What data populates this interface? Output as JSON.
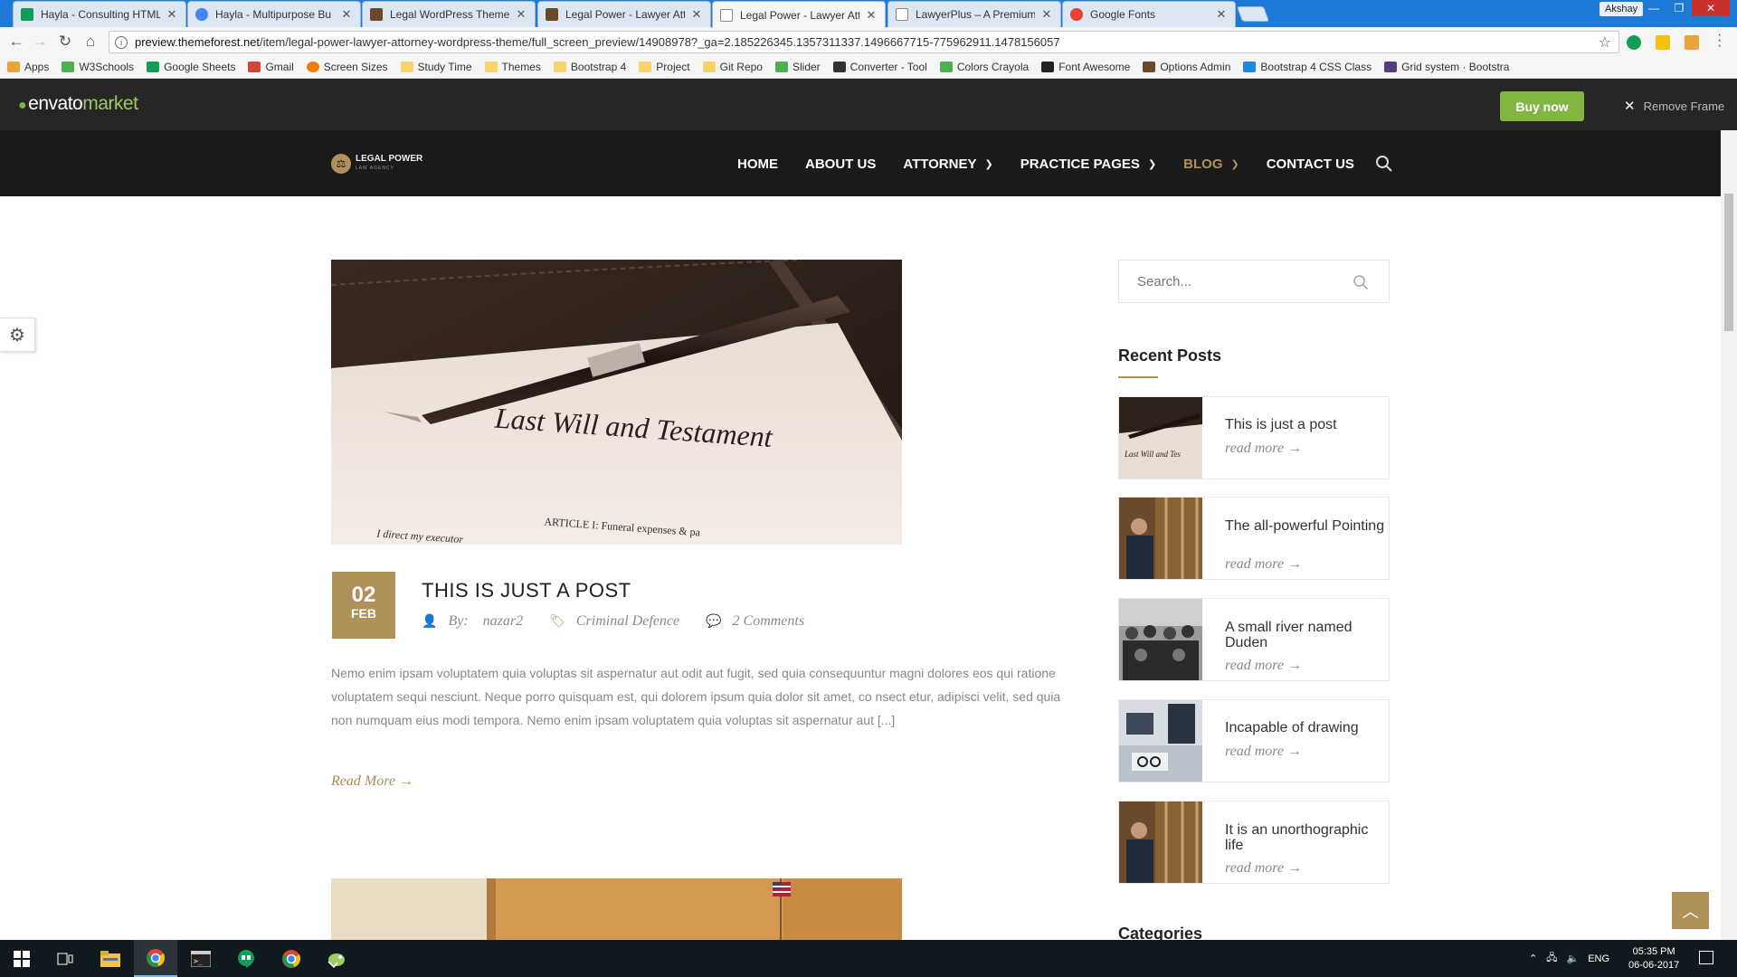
{
  "browser": {
    "tabs": [
      {
        "label": "Hayla - Consulting HTML",
        "favicon_color": "#0f9d58",
        "active": false
      },
      {
        "label": "Hayla - Multipurpose Bu",
        "favicon_color": "#4285f4",
        "active": false
      },
      {
        "label": "Legal WordPress Theme",
        "favicon_color": "#6b4a2a",
        "active": false
      },
      {
        "label": "Legal Power - Lawyer Att",
        "favicon_color": "#6b4a2a",
        "active": false
      },
      {
        "label": "Legal Power - Lawyer Att",
        "favicon_color": "#888888",
        "active": true
      },
      {
        "label": "LawyerPlus – A Premium",
        "favicon_color": "#888888",
        "active": false
      },
      {
        "label": "Google Fonts",
        "favicon_color": "#e94235",
        "active": false
      }
    ],
    "profile_name": "Akshay",
    "url_host": "preview.themeforest.net",
    "url_path": "/item/legal-power-lawyer-attorney-wordpress-theme/full_screen_preview/14908978?_ga=2.185226345.1357311337.1496667715-775962911.1478156057",
    "bookmarks": [
      {
        "label": "Apps",
        "color": "#e8a33c"
      },
      {
        "label": "W3Schools",
        "color": "#4caf50"
      },
      {
        "label": "Google Sheets",
        "color": "#0f9d58"
      },
      {
        "label": "Gmail",
        "color": "#d44638"
      },
      {
        "label": "Screen Sizes",
        "color": "#f57c00"
      },
      {
        "label": "Study Time",
        "color": "#f7d46b"
      },
      {
        "label": "Themes",
        "color": "#f7d46b"
      },
      {
        "label": "Bootstrap 4",
        "color": "#f7d46b"
      },
      {
        "label": "Project",
        "color": "#f7d46b"
      },
      {
        "label": "Git Repo",
        "color": "#f7d46b"
      },
      {
        "label": "Slider",
        "color": "#4caf50"
      },
      {
        "label": "Converter - Tool",
        "color": "#333333"
      },
      {
        "label": "Colors Crayola",
        "color": "#4caf50"
      },
      {
        "label": "Font Awesome",
        "color": "#222222"
      },
      {
        "label": "Options Admin",
        "color": "#6b4a2a"
      },
      {
        "label": "Bootstrap 4 CSS Class",
        "color": "#1e88e5"
      },
      {
        "label": "Grid system · Bootstra",
        "color": "#563d7c"
      }
    ]
  },
  "envato": {
    "logo_main": "envato",
    "logo_sub": "market",
    "buy_label": "Buy now",
    "remove_frame_label": "Remove Frame",
    "accent": "#82b541"
  },
  "site": {
    "logo_title": "LEGAL POWER",
    "logo_tagline": "LAW AGENCY",
    "accent": "#b0915a",
    "nav": [
      {
        "label": "HOME",
        "has_caret": false,
        "active": false
      },
      {
        "label": "ABOUT US",
        "has_caret": false,
        "active": false
      },
      {
        "label": "ATTORNEY",
        "has_caret": true,
        "active": false
      },
      {
        "label": "PRACTICE PAGES",
        "has_caret": true,
        "active": false
      },
      {
        "label": "BLOG",
        "has_caret": true,
        "active": true
      },
      {
        "label": "CONTACT US",
        "has_caret": false,
        "active": false
      }
    ]
  },
  "post": {
    "image_caption": "Last Will and Testament",
    "image_subtext": "ARTICLE I: Funeral expenses & pa",
    "image_subtext2": "I direct my executor",
    "date_day": "02",
    "date_month": "FEB",
    "title": "THIS IS JUST A POST",
    "by_label": "By:",
    "author": "nazar2",
    "category": "Criminal Defence",
    "comments": "2 Comments",
    "excerpt": "Nemo enim ipsam voluptatem quia voluptas sit aspernatur aut odit aut fugit, sed quia consequuntur magni dolores eos qui ratione voluptatem sequi nesciunt. Neque porro quisquam est, qui dolorem ipsum quia dolor sit amet, co nsect etur, adipisci velit, sed quia non numquam eius modi tempora. Nemo enim ipsam voluptatem quia voluptas sit aspernatur aut [...]",
    "read_more": "Read More →"
  },
  "sidebar": {
    "search_placeholder": "Search...",
    "recent_heading": "Recent Posts",
    "recent_posts": [
      {
        "title": "This is just a post",
        "more": "read more →",
        "thumb": "document"
      },
      {
        "title": "The all-powerful Pointing",
        "more": "read more →",
        "thumb": "library"
      },
      {
        "title": "A small river named Duden",
        "more": "read more →",
        "thumb": "courtroom"
      },
      {
        "title": "Incapable of drawing",
        "more": "read more →",
        "thumb": "desk"
      },
      {
        "title": "It is an unorthographic life",
        "more": "read more →",
        "thumb": "library"
      }
    ],
    "categories_heading": "Categories"
  },
  "taskbar": {
    "language": "ENG",
    "time": "05:35 PM",
    "date": "06-06-2017"
  }
}
